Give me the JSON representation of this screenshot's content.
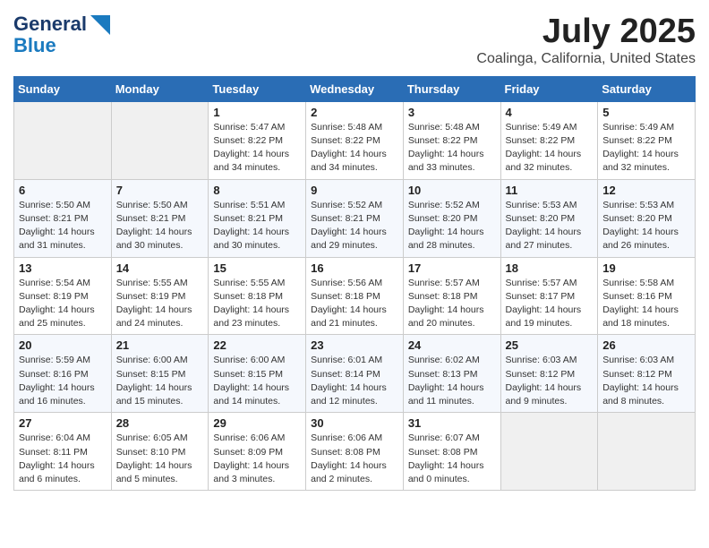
{
  "header": {
    "logo_line1": "General",
    "logo_line2": "Blue",
    "title": "July 2025",
    "subtitle": "Coalinga, California, United States"
  },
  "calendar": {
    "days_of_week": [
      "Sunday",
      "Monday",
      "Tuesday",
      "Wednesday",
      "Thursday",
      "Friday",
      "Saturday"
    ],
    "weeks": [
      [
        {
          "day": "",
          "info": ""
        },
        {
          "day": "",
          "info": ""
        },
        {
          "day": "1",
          "info": "Sunrise: 5:47 AM\nSunset: 8:22 PM\nDaylight: 14 hours\nand 34 minutes."
        },
        {
          "day": "2",
          "info": "Sunrise: 5:48 AM\nSunset: 8:22 PM\nDaylight: 14 hours\nand 34 minutes."
        },
        {
          "day": "3",
          "info": "Sunrise: 5:48 AM\nSunset: 8:22 PM\nDaylight: 14 hours\nand 33 minutes."
        },
        {
          "day": "4",
          "info": "Sunrise: 5:49 AM\nSunset: 8:22 PM\nDaylight: 14 hours\nand 32 minutes."
        },
        {
          "day": "5",
          "info": "Sunrise: 5:49 AM\nSunset: 8:22 PM\nDaylight: 14 hours\nand 32 minutes."
        }
      ],
      [
        {
          "day": "6",
          "info": "Sunrise: 5:50 AM\nSunset: 8:21 PM\nDaylight: 14 hours\nand 31 minutes."
        },
        {
          "day": "7",
          "info": "Sunrise: 5:50 AM\nSunset: 8:21 PM\nDaylight: 14 hours\nand 30 minutes."
        },
        {
          "day": "8",
          "info": "Sunrise: 5:51 AM\nSunset: 8:21 PM\nDaylight: 14 hours\nand 30 minutes."
        },
        {
          "day": "9",
          "info": "Sunrise: 5:52 AM\nSunset: 8:21 PM\nDaylight: 14 hours\nand 29 minutes."
        },
        {
          "day": "10",
          "info": "Sunrise: 5:52 AM\nSunset: 8:20 PM\nDaylight: 14 hours\nand 28 minutes."
        },
        {
          "day": "11",
          "info": "Sunrise: 5:53 AM\nSunset: 8:20 PM\nDaylight: 14 hours\nand 27 minutes."
        },
        {
          "day": "12",
          "info": "Sunrise: 5:53 AM\nSunset: 8:20 PM\nDaylight: 14 hours\nand 26 minutes."
        }
      ],
      [
        {
          "day": "13",
          "info": "Sunrise: 5:54 AM\nSunset: 8:19 PM\nDaylight: 14 hours\nand 25 minutes."
        },
        {
          "day": "14",
          "info": "Sunrise: 5:55 AM\nSunset: 8:19 PM\nDaylight: 14 hours\nand 24 minutes."
        },
        {
          "day": "15",
          "info": "Sunrise: 5:55 AM\nSunset: 8:18 PM\nDaylight: 14 hours\nand 23 minutes."
        },
        {
          "day": "16",
          "info": "Sunrise: 5:56 AM\nSunset: 8:18 PM\nDaylight: 14 hours\nand 21 minutes."
        },
        {
          "day": "17",
          "info": "Sunrise: 5:57 AM\nSunset: 8:18 PM\nDaylight: 14 hours\nand 20 minutes."
        },
        {
          "day": "18",
          "info": "Sunrise: 5:57 AM\nSunset: 8:17 PM\nDaylight: 14 hours\nand 19 minutes."
        },
        {
          "day": "19",
          "info": "Sunrise: 5:58 AM\nSunset: 8:16 PM\nDaylight: 14 hours\nand 18 minutes."
        }
      ],
      [
        {
          "day": "20",
          "info": "Sunrise: 5:59 AM\nSunset: 8:16 PM\nDaylight: 14 hours\nand 16 minutes."
        },
        {
          "day": "21",
          "info": "Sunrise: 6:00 AM\nSunset: 8:15 PM\nDaylight: 14 hours\nand 15 minutes."
        },
        {
          "day": "22",
          "info": "Sunrise: 6:00 AM\nSunset: 8:15 PM\nDaylight: 14 hours\nand 14 minutes."
        },
        {
          "day": "23",
          "info": "Sunrise: 6:01 AM\nSunset: 8:14 PM\nDaylight: 14 hours\nand 12 minutes."
        },
        {
          "day": "24",
          "info": "Sunrise: 6:02 AM\nSunset: 8:13 PM\nDaylight: 14 hours\nand 11 minutes."
        },
        {
          "day": "25",
          "info": "Sunrise: 6:03 AM\nSunset: 8:12 PM\nDaylight: 14 hours\nand 9 minutes."
        },
        {
          "day": "26",
          "info": "Sunrise: 6:03 AM\nSunset: 8:12 PM\nDaylight: 14 hours\nand 8 minutes."
        }
      ],
      [
        {
          "day": "27",
          "info": "Sunrise: 6:04 AM\nSunset: 8:11 PM\nDaylight: 14 hours\nand 6 minutes."
        },
        {
          "day": "28",
          "info": "Sunrise: 6:05 AM\nSunset: 8:10 PM\nDaylight: 14 hours\nand 5 minutes."
        },
        {
          "day": "29",
          "info": "Sunrise: 6:06 AM\nSunset: 8:09 PM\nDaylight: 14 hours\nand 3 minutes."
        },
        {
          "day": "30",
          "info": "Sunrise: 6:06 AM\nSunset: 8:08 PM\nDaylight: 14 hours\nand 2 minutes."
        },
        {
          "day": "31",
          "info": "Sunrise: 6:07 AM\nSunset: 8:08 PM\nDaylight: 14 hours\nand 0 minutes."
        },
        {
          "day": "",
          "info": ""
        },
        {
          "day": "",
          "info": ""
        }
      ]
    ]
  }
}
